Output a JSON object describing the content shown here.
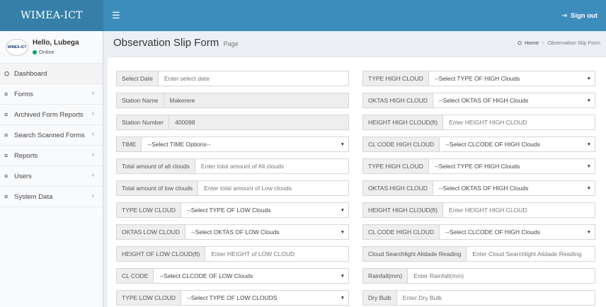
{
  "app": {
    "logo": "WIMEA-ICT",
    "signout_label": "Sign out"
  },
  "user": {
    "greeting": "Hello, Lubega",
    "status": "Online",
    "avatar_text": "WIMEA-ICT"
  },
  "sidebar": {
    "items": [
      {
        "label": "Dashboard",
        "icon": "dashboard-icon",
        "glyph": "⛭",
        "chevron": ""
      },
      {
        "label": "Forms",
        "icon": "menu-icon",
        "glyph": "≡",
        "chevron": "‹"
      },
      {
        "label": "Archived Form Reports",
        "icon": "menu-icon",
        "glyph": "≡",
        "chevron": "‹"
      },
      {
        "label": "Search Scanned Forms",
        "icon": "menu-icon",
        "glyph": "≡",
        "chevron": "‹"
      },
      {
        "label": "Reports",
        "icon": "menu-icon",
        "glyph": "≡",
        "chevron": "‹"
      },
      {
        "label": "Users",
        "icon": "menu-icon",
        "glyph": "≡",
        "chevron": "‹"
      },
      {
        "label": "System Data",
        "icon": "menu-icon",
        "glyph": "≡",
        "chevron": "‹"
      }
    ]
  },
  "header": {
    "title": "Observation Slip Form",
    "subtitle": "Page",
    "breadcrumb_home": "Home",
    "breadcrumb_sep": ">",
    "breadcrumb_current": "Observation Slip Form"
  },
  "form": {
    "left": [
      {
        "label": "Select Date",
        "type": "input",
        "placeholder": "Enter select date"
      },
      {
        "label": "Station Name",
        "type": "readonly",
        "value": "Makerere"
      },
      {
        "label": "Station Number",
        "type": "readonly",
        "value": "400098"
      },
      {
        "label": "TIME",
        "type": "select",
        "value": "--Select TIME Options--"
      },
      {
        "label": "Total amount of all clouds",
        "type": "input",
        "placeholder": "Enter total amount of All clouds"
      },
      {
        "label": "Total amount of low clouds",
        "type": "input",
        "placeholder": "Enter total amount of Low clouds"
      },
      {
        "label": "TYPE LOW CLOUD",
        "type": "select",
        "value": "--Select TYPE OF LOW Clouds"
      },
      {
        "label": "OKTAS LOW CLOUD",
        "type": "select",
        "value": "--Select OKTAS OF LOW Clouds"
      },
      {
        "label": "HEIGHT OF LOW CLOUD(ft)",
        "type": "input",
        "placeholder": "Enter HEIGHT  of LOW CLOUD"
      },
      {
        "label": "CL CODE",
        "type": "select",
        "value": "--Select CLCODE OF LOW Clouds"
      },
      {
        "label": "TYPE LOW CLOUD",
        "type": "select",
        "value": "--Select TYPE OF LOW CLOUDS"
      }
    ],
    "right": [
      {
        "label": "TYPE HIGH CLOUD",
        "type": "select",
        "value": "--Select TYPE OF HIGH Clouds"
      },
      {
        "label": "OKTAS HIGH CLOUD",
        "type": "select",
        "value": "--Select OKTAS OF HIGH Clouds"
      },
      {
        "label": "HEIGHT HIGH CLOUD(ft)",
        "type": "input",
        "placeholder": "Enter HEIGHT HIGH CLOUD"
      },
      {
        "label": "CL CODE HIGH CLOUD",
        "type": "select",
        "value": "--Select CLCODE OF HIGH Clouds"
      },
      {
        "label": "TYPE HIGH CLOUD",
        "type": "select",
        "value": "--Select TYPE OF HIGH Clouds"
      },
      {
        "label": "OKTAS HIGH CLOUD",
        "type": "select",
        "value": "--Select OKTAS OF HIGH Clouds"
      },
      {
        "label": "HEIGHT HIGH CLOUD(ft)",
        "type": "input",
        "placeholder": "Enter HEIGHT HIGH CLOUD"
      },
      {
        "label": "CL CODE HIGH CLOUD",
        "type": "select",
        "value": "--Select CLCODE OF HIGH Clouds"
      },
      {
        "label": "Cloud Searchlight Alidade Reading",
        "type": "input",
        "placeholder": "Enter Cloud Searchlight Alidade Reading"
      },
      {
        "label": "Rainfall(mm)",
        "type": "input",
        "placeholder": "Enter Rainfall(mm)"
      },
      {
        "label": "Dry Bulb",
        "type": "input",
        "placeholder": "Enter Dry Bulb"
      }
    ]
  },
  "colors": {
    "navbar": "#3c8dbc",
    "logo_bg": "#367fa9",
    "online": "#00a65a"
  }
}
